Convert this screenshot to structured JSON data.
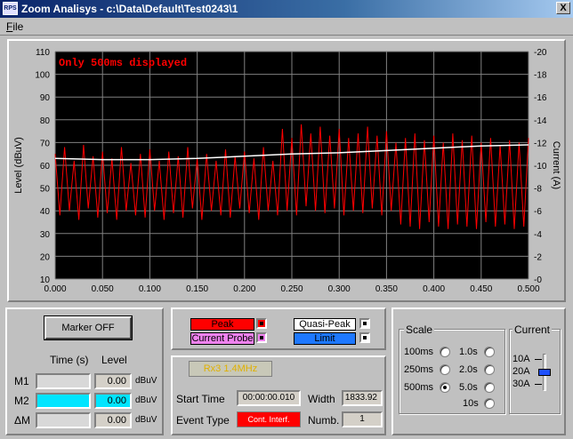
{
  "window": {
    "title": "Zoom Analisys - c:\\Data\\Default\\Test0243\\1",
    "close_glyph": "X",
    "icon_text": "RPS"
  },
  "menu": {
    "file": "File"
  },
  "chart_data": {
    "type": "line",
    "annotation": "Only 500ms displayed",
    "ylabel": "Level (dBuV)",
    "ylabel_right": "Current (A)",
    "xlim": [
      0,
      0.5
    ],
    "ylim": [
      10,
      110
    ],
    "ylim_right": [
      0,
      20
    ],
    "x_ticks": [
      "0.000",
      "0.050",
      "0.100",
      "0.150",
      "0.200",
      "0.250",
      "0.300",
      "0.350",
      "0.400",
      "0.450",
      "0.500"
    ],
    "y_ticks": [
      "10",
      "20",
      "30",
      "40",
      "50",
      "60",
      "70",
      "80",
      "90",
      "100",
      "110"
    ],
    "y_ticks_right": [
      "0",
      "2",
      "4",
      "6",
      "8",
      "10",
      "12",
      "14",
      "16",
      "18",
      "20"
    ],
    "grid": true,
    "series": [
      {
        "color": "#ff0000",
        "x": [
          0.0,
          0.005,
          0.01,
          0.015,
          0.02,
          0.025,
          0.03,
          0.035,
          0.04,
          0.045,
          0.05,
          0.055,
          0.06,
          0.065,
          0.07,
          0.075,
          0.08,
          0.085,
          0.09,
          0.095,
          0.1,
          0.105,
          0.11,
          0.115,
          0.12,
          0.125,
          0.13,
          0.135,
          0.14,
          0.145,
          0.15,
          0.155,
          0.16,
          0.165,
          0.17,
          0.175,
          0.18,
          0.185,
          0.19,
          0.195,
          0.2,
          0.205,
          0.21,
          0.215,
          0.22,
          0.225,
          0.23,
          0.235,
          0.24,
          0.245,
          0.25,
          0.255,
          0.26,
          0.265,
          0.27,
          0.275,
          0.28,
          0.285,
          0.29,
          0.295,
          0.3,
          0.305,
          0.31,
          0.315,
          0.32,
          0.325,
          0.33,
          0.335,
          0.34,
          0.345,
          0.35,
          0.355,
          0.36,
          0.365,
          0.37,
          0.375,
          0.38,
          0.385,
          0.39,
          0.395,
          0.4,
          0.405,
          0.41,
          0.415,
          0.42,
          0.425,
          0.43,
          0.435,
          0.44,
          0.445,
          0.45,
          0.455,
          0.46,
          0.465,
          0.47,
          0.475,
          0.48,
          0.485,
          0.49,
          0.495,
          0.5
        ],
        "y": [
          65,
          38,
          68,
          40,
          62,
          36,
          69,
          41,
          64,
          37,
          66,
          39,
          63,
          36,
          68,
          40,
          61,
          38,
          65,
          37,
          67,
          40,
          62,
          36,
          66,
          39,
          64,
          37,
          68,
          41,
          63,
          36,
          65,
          40,
          62,
          38,
          67,
          37,
          64,
          41,
          66,
          39,
          63,
          36,
          68,
          40,
          62,
          38,
          76,
          40,
          72,
          38,
          78,
          42,
          74,
          40,
          77,
          39,
          73,
          41,
          76,
          38,
          72,
          40,
          74,
          39,
          77,
          41,
          73,
          38,
          75,
          40,
          70,
          34,
          72,
          33,
          74,
          32,
          71,
          35,
          73,
          33,
          70,
          32,
          74,
          34,
          71,
          33,
          73,
          32,
          70,
          35,
          72,
          33,
          69,
          34,
          71,
          32,
          70,
          33,
          72
        ]
      },
      {
        "color": "#ffffff",
        "x": [
          0.0,
          0.05,
          0.1,
          0.15,
          0.2,
          0.25,
          0.3,
          0.35,
          0.4,
          0.45,
          0.5
        ],
        "y": [
          10.6,
          10.5,
          10.5,
          10.6,
          10.8,
          11.0,
          11.1,
          11.3,
          11.5,
          11.7,
          11.8
        ]
      }
    ]
  },
  "marker": {
    "button": "Marker OFF",
    "time_header": "Time (s)",
    "level_header": "Level",
    "rows": [
      {
        "label": "M1",
        "time": "",
        "level": "0.00",
        "unit": "dBuV",
        "color": "#d8d8d8"
      },
      {
        "label": "M2",
        "time": "",
        "level": "0.00",
        "unit": "dBuV",
        "color": "#00e5ff"
      },
      {
        "label": "ΔM",
        "time": "",
        "level": "0.00",
        "unit": "dBuV",
        "color": "#d8d8d8"
      }
    ]
  },
  "traces": {
    "peak": {
      "label": "Peak",
      "color": "#ff0000"
    },
    "current_probe": {
      "label": "Current Probe",
      "color": "#ee82ee"
    },
    "quasi_peak": {
      "label": "Quasi-Peak",
      "color": "#ffffff"
    },
    "limit": {
      "label": "Limit",
      "color": "#1e78ff"
    }
  },
  "event": {
    "receiver": "Rx3 1.4MHz",
    "start_time_label": "Start Time",
    "start_time": "00:00:00.010",
    "width_label": "Width",
    "width": "1833.92",
    "event_type_label": "Event Type",
    "event_type": "Cont. Interf.",
    "numb_label": "Numb.",
    "numb": "1"
  },
  "scale": {
    "title": "Scale",
    "options": [
      "100ms",
      "250ms",
      "500ms",
      "1.0s",
      "2.0s",
      "5.0s",
      "10s"
    ],
    "selected": "500ms"
  },
  "current": {
    "title": "Current",
    "options": [
      "10A",
      "20A",
      "30A"
    ],
    "selected": "20A"
  }
}
